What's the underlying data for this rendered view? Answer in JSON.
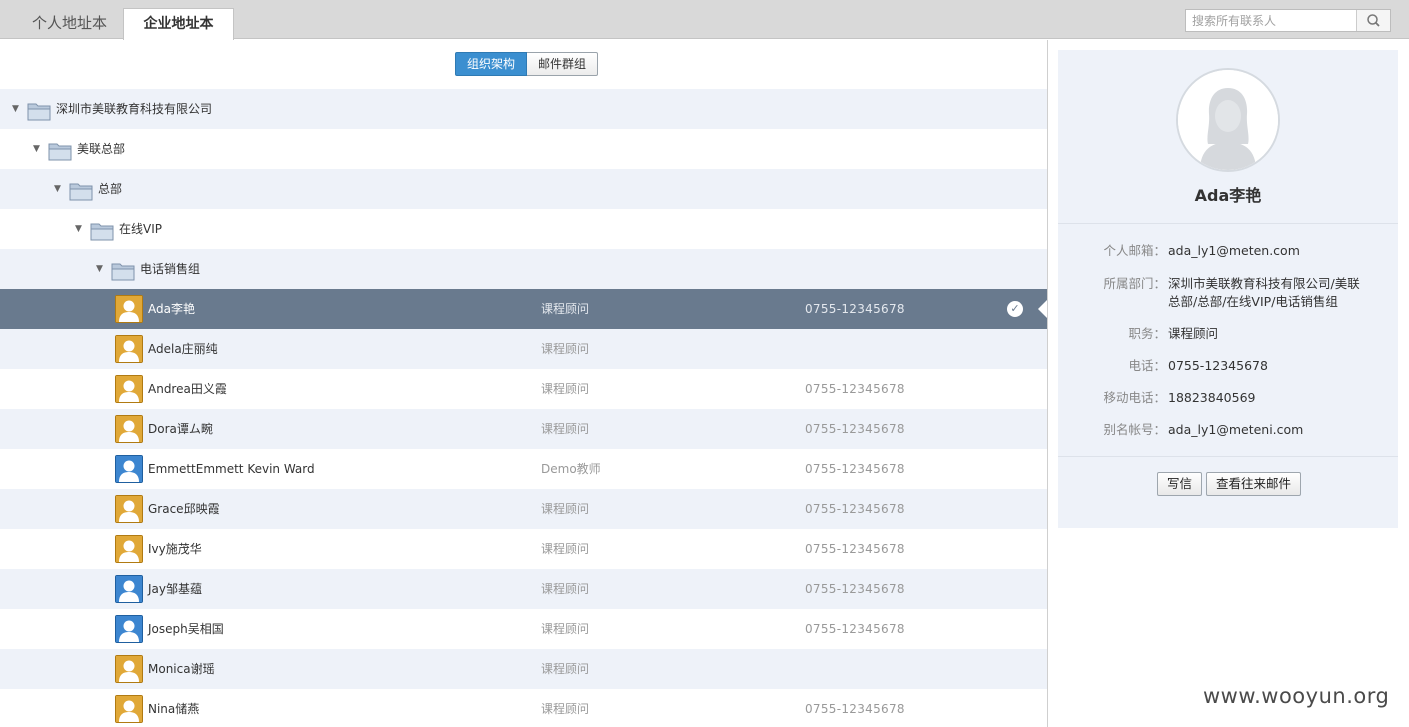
{
  "tabs": [
    {
      "label": "个人地址本",
      "active": false
    },
    {
      "label": "企业地址本",
      "active": true
    }
  ],
  "search": {
    "placeholder": "搜索所有联系人"
  },
  "view_toggle": {
    "org_label": "组织架构",
    "group_label": "邮件群组",
    "active": "org"
  },
  "tree": [
    {
      "label": "深圳市美联教育科技有限公司",
      "level": 0
    },
    {
      "label": "美联总部",
      "level": 1
    },
    {
      "label": "总部",
      "level": 2
    },
    {
      "label": "在线VIP",
      "level": 3
    },
    {
      "label": "电话销售组",
      "level": 4
    }
  ],
  "contacts": [
    {
      "name": "Ada李艳",
      "role": "课程顾问",
      "phone": "0755-12345678",
      "avatar": "female",
      "selected": true
    },
    {
      "name": "Adela庄丽纯",
      "role": "课程顾问",
      "phone": "",
      "avatar": "female"
    },
    {
      "name": "Andrea田义霞",
      "role": "课程顾问",
      "phone": "0755-12345678",
      "avatar": "female"
    },
    {
      "name": "Dora谭ム畹",
      "role": "课程顾问",
      "phone": "0755-12345678",
      "avatar": "female"
    },
    {
      "name": "EmmettEmmett Kevin Ward",
      "role": "Demo教师",
      "phone": "0755-12345678",
      "avatar": "male"
    },
    {
      "name": "Grace邱映霞",
      "role": "课程顾问",
      "phone": "0755-12345678",
      "avatar": "female"
    },
    {
      "name": "Ivy施茂华",
      "role": "课程顾问",
      "phone": "0755-12345678",
      "avatar": "female"
    },
    {
      "name": "Jay邹基蕴",
      "role": "课程顾问",
      "phone": "0755-12345678",
      "avatar": "male"
    },
    {
      "name": "Joseph吴相国",
      "role": "课程顾问",
      "phone": "0755-12345678",
      "avatar": "male"
    },
    {
      "name": "Monica谢瑶",
      "role": "课程顾问",
      "phone": "",
      "avatar": "female"
    },
    {
      "name": "Nina储燕",
      "role": "课程顾问",
      "phone": "0755-12345678",
      "avatar": "female"
    }
  ],
  "detail": {
    "name": "Ada李艳",
    "fields": [
      {
        "label": "个人邮箱：",
        "value": "ada_ly1@meten.com"
      },
      {
        "label": "所属部门：",
        "value": "深圳市美联教育科技有限公司/美联总部/总部/在线VIP/电话销售组"
      },
      {
        "label": "职务：",
        "value": "课程顾问"
      },
      {
        "label": "电话：",
        "value": "0755-12345678"
      },
      {
        "label": "移动电话：",
        "value": "18823840569"
      },
      {
        "label": "别名帐号：",
        "value": "ada_ly1@meteni.com"
      }
    ],
    "write_label": "写信",
    "history_label": "查看往来邮件"
  },
  "watermark": "www.wooyun.org",
  "colors": {
    "selected_row": "#697a8e",
    "alt_row": "#eef2f9",
    "toggle_active": "#3b8fd0",
    "female_avatar": "#e0a838",
    "male_avatar": "#3d86d0"
  }
}
